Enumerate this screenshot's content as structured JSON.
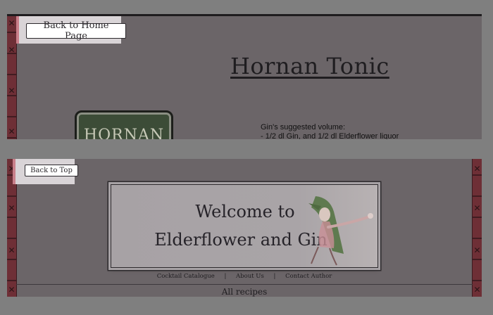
{
  "top_view": {
    "back_button": "Back to Home Page",
    "title": "Hornan Tonic",
    "sign_text": "HORNAN",
    "volume_heading": "Gin's suggested volume:",
    "volume_line": "- 1/2 dl Gin, and 1/2 dl Elderflower liquor"
  },
  "bottom_view": {
    "back_button": "Back to Top",
    "banner_line1": "Welcome to",
    "banner_line2": "Elderflower and Gin",
    "nav": [
      "Cocktail Catalogue",
      "About Us",
      "Contact Author"
    ],
    "nav_separator": "|",
    "section_title": "All recipes"
  },
  "colors": {
    "page_background": "#6b6568",
    "border_strip": "#6e2f36",
    "button_area": "#d9d4d7",
    "sign_background": "#3c4c37"
  },
  "icons": [
    "cross-ornament-icon",
    "fairy-illustration"
  ]
}
